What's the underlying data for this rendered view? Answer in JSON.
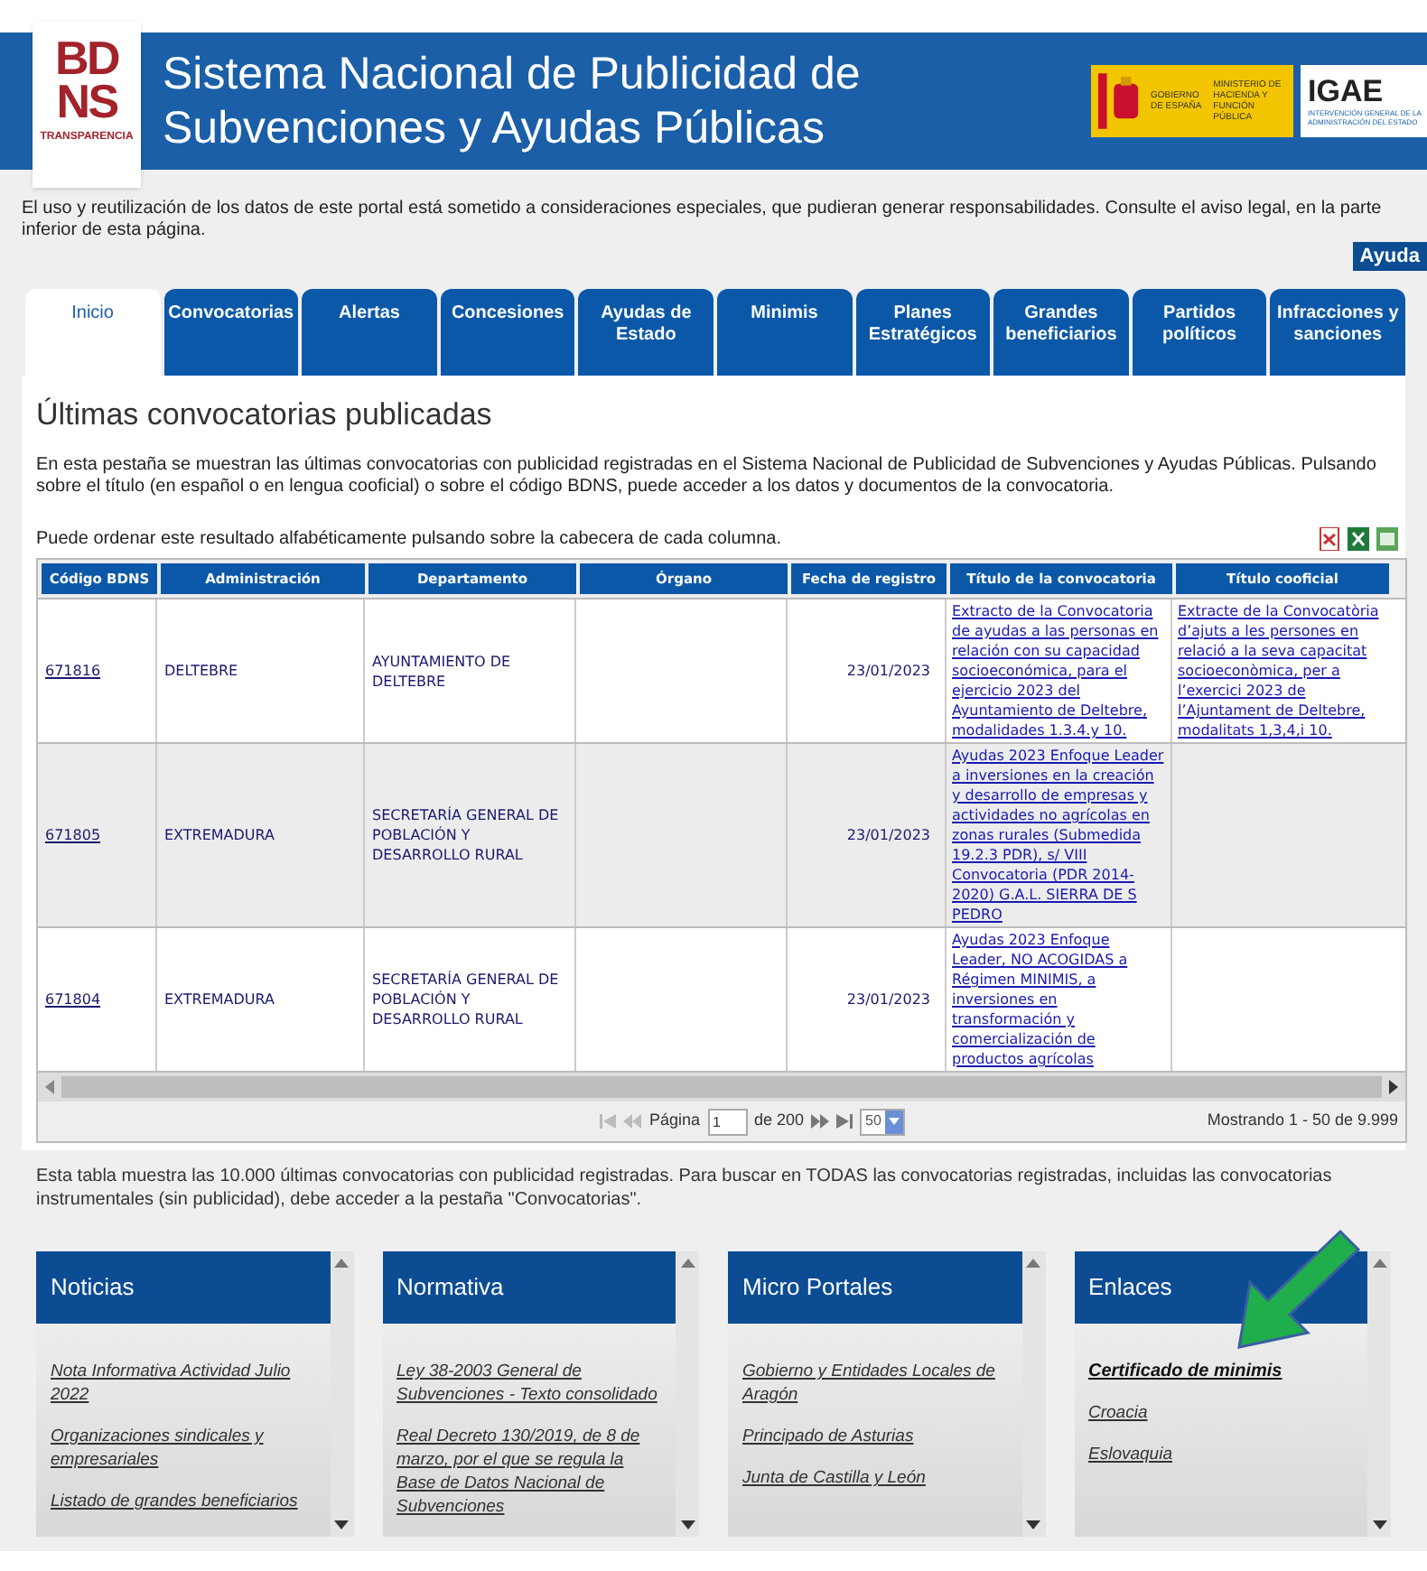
{
  "header": {
    "logo": {
      "line1": "BD",
      "line2": "NS",
      "tagline": "TRANSPARENCIA"
    },
    "title_lines": [
      "Sistema Nacional de Publicidad de",
      "Subvenciones y Ayudas Públicas"
    ],
    "gov_logo": {
      "gobierno": "GOBIERNO DE ESPAÑA",
      "ministerio": "MINISTERIO DE HACIENDA Y FUNCIÓN PÚBLICA"
    },
    "igae": {
      "name": "IGAE",
      "subtitle_lines": [
        "INTERVENCIÓN GENERAL DE LA",
        "ADMINISTRACIÓN DEL ESTADO"
      ]
    }
  },
  "notice": "El uso y reutilización de los datos de este portal está sometido a consideraciones especiales, que pudieran generar responsabilidades. Consulte el aviso legal, en la parte inferior de esta página.",
  "help_button": "Ayuda",
  "tabs": [
    {
      "label": "Inicio",
      "selected": true
    },
    {
      "label": "Convocatorias",
      "selected": false
    },
    {
      "label": "Alertas",
      "selected": false
    },
    {
      "label": "Concesiones",
      "selected": false
    },
    {
      "label": "Ayudas de Estado",
      "selected": false
    },
    {
      "label": "Minimis",
      "selected": false
    },
    {
      "label": "Planes Estratégicos",
      "selected": false
    },
    {
      "label": "Grandes beneficiarios",
      "selected": false
    },
    {
      "label": "Partidos políticos",
      "selected": false
    },
    {
      "label": "Infracciones y sanciones",
      "selected": false
    }
  ],
  "section_title": "Últimas convocatorias publicadas",
  "intro": [
    "En esta pestaña se muestran las últimas convocatorias con publicidad registradas en el Sistema Nacional de Publicidad de Subvenciones y Ayudas Públicas. Pulsando sobre el título (en español o en lengua cooficial) o sobre el código BDNS, puede acceder a los datos y documentos de la convocatoria.",
    "Puede ordenar este resultado alfabéticamente pulsando sobre la cabecera de cada columna."
  ],
  "table": {
    "columns": [
      "Código BDNS",
      "Administración",
      "Departamento",
      "Órgano",
      "Fecha de registro",
      "Título de la convocatoria",
      "Título cooficial"
    ],
    "rows": [
      {
        "selected": false,
        "code": "671816",
        "administracion": "DELTEBRE",
        "departamento": "AYUNTAMIENTO DE DELTEBRE",
        "fecha": "23/01/2023",
        "titulo": "Extracto de la Convocatoria de ayudas a las personas en relación con su capacidad socioeconómica, para el ejercicio 2023 del Ayuntamiento de Deltebre, modalidades 1.3.4.y 10.",
        "titulo_cooficial": "Extracte de la Convocatòria d’ajuts a les persones en relació a la seva capacitat socioeconòmica, per a l’exercici 2023 de l’Ajuntament de Deltebre, modalitats 1,3,4,i 10."
      },
      {
        "selected": true,
        "code": "671805",
        "administracion": "EXTREMADURA",
        "departamento": "SECRETARÍA GENERAL DE POBLACIÓN Y DESARROLLO RURAL",
        "fecha": "23/01/2023",
        "titulo": "Ayudas 2023 Enfoque Leader a inversiones en la creación y desarrollo de empresas y actividades no agrícolas en zonas rurales (Submedida 19.2.3 PDR), s/ VIII Convocatoria (PDR 2014-2020) G.A.L. SIERRA DE S PEDRO"
      },
      {
        "selected": false,
        "code": "671804",
        "administracion": "EXTREMADURA",
        "departamento": "SECRETARÍA GENERAL DE POBLACIÓN Y DESARROLLO RURAL",
        "fecha": "23/01/2023",
        "titulo": "Ayudas 2023 Enfoque Leader, NO ACOGIDAS a Régimen MINIMIS, a inversiones en transformación y comercialización de productos agrícolas"
      }
    ]
  },
  "pagination": {
    "page_label": "Página",
    "page": "1",
    "of": "de 200",
    "per_page": "50",
    "summary": "Mostrando 1 - 50 de 9.999"
  },
  "footnote": "Esta tabla muestra las 10.000 últimas convocatorias con publicidad registradas. Para buscar en TODAS las convocatorias registradas, incluidas las convocatorias instrumentales (sin publicidad), debe acceder a la pestaña \"Convocatorias\".",
  "panels": [
    {
      "title": "Noticias",
      "links": [
        {
          "text": "Nota Informativa Actividad Julio 2022",
          "bold": false
        },
        {
          "text": "Organizaciones sindicales y empresariales",
          "bold": false
        },
        {
          "text": "Listado de grandes beneficiarios",
          "bold": false
        }
      ]
    },
    {
      "title": "Normativa",
      "links": [
        {
          "text": "Ley 38-2003 General de Subvenciones - Texto consolidado",
          "bold": false
        },
        {
          "text": "Real Decreto 130/2019, de 8 de marzo, por el que se regula la Base de Datos Nacional de Subvenciones",
          "bold": false
        }
      ]
    },
    {
      "title": "Micro Portales",
      "links": [
        {
          "text": "Gobierno y Entidades Locales de Aragón",
          "bold": false
        },
        {
          "text": "Principado de Asturias",
          "bold": false
        },
        {
          "text": "Junta de Castilla y León",
          "bold": false
        }
      ]
    },
    {
      "title": "Enlaces",
      "links": [
        {
          "text": "Certificado de minimis",
          "bold": true
        },
        {
          "text": "Croacia",
          "bold": false
        },
        {
          "text": "Eslovaquia",
          "bold": false
        }
      ]
    }
  ]
}
